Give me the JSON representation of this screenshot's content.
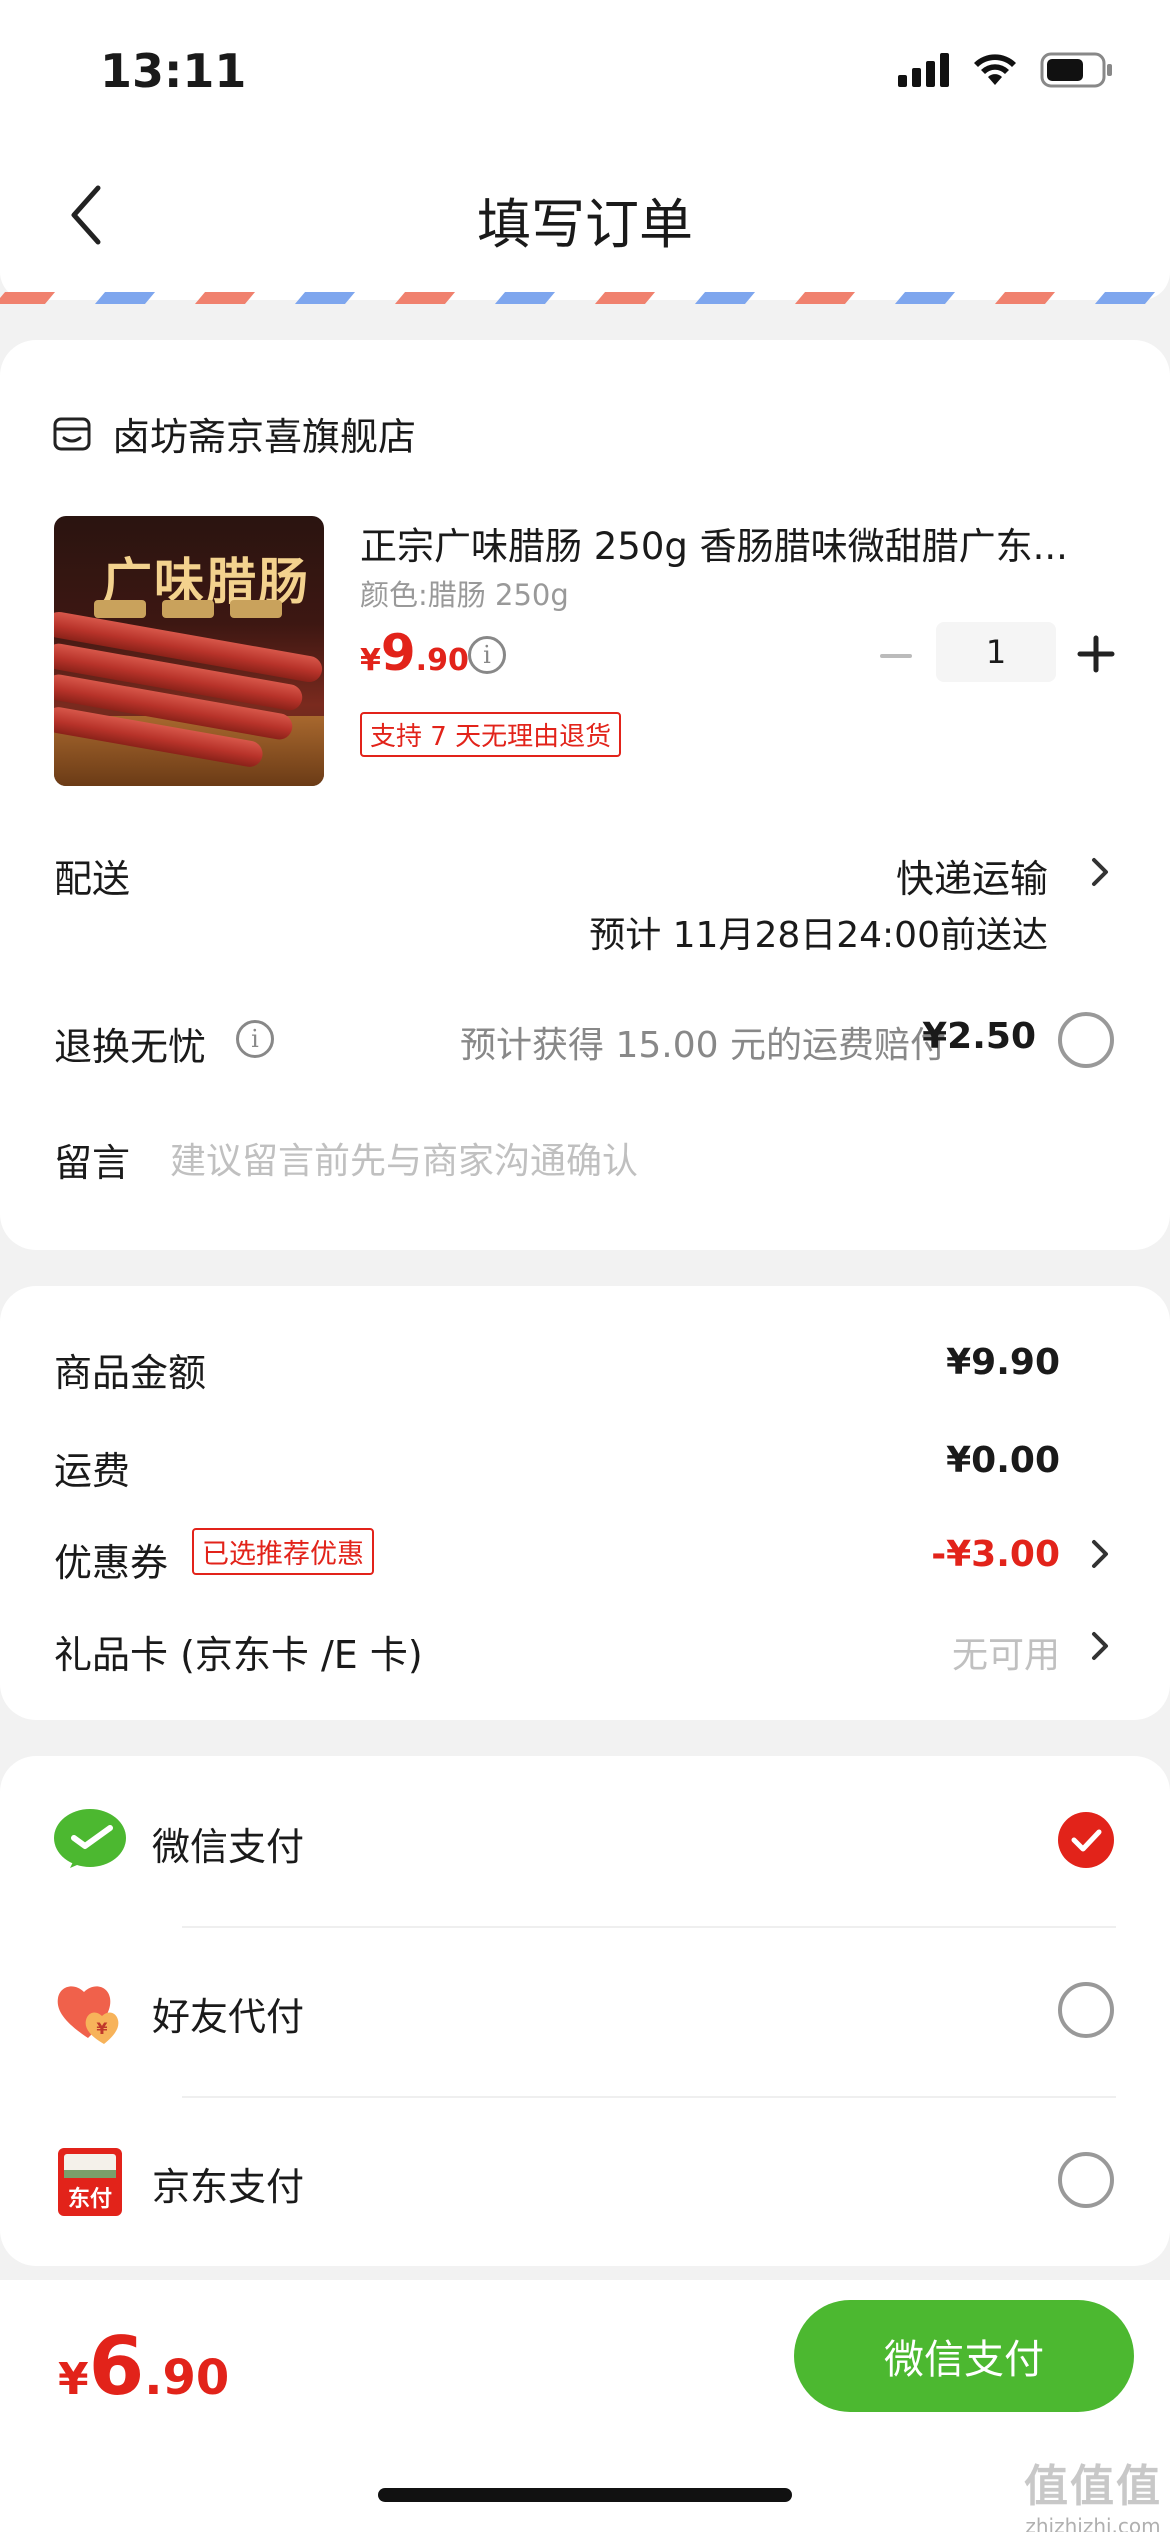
{
  "status_bar": {
    "time": "13:11"
  },
  "nav": {
    "title": "填写订单"
  },
  "store": {
    "name": "卤坊斋京喜旗舰店"
  },
  "product": {
    "image_text": "广味腊肠",
    "title": "正宗广味腊肠 250g 香肠腊味微甜腊广东...",
    "spec": "颜色:腊肠 250g",
    "price": {
      "currency": "¥",
      "integer": "9",
      "decimal": ".90"
    },
    "quantity": "1",
    "return_badge": "支持 7 天无理由退货"
  },
  "delivery": {
    "label": "配送",
    "method": "快递运输",
    "eta": "预计 11月28日24:00前送达"
  },
  "refund": {
    "label": "退换无忧",
    "text": "预计获得 15.00 元的运费赔付",
    "price": "¥2.50"
  },
  "message": {
    "label": "留言",
    "placeholder": "建议留言前先与商家沟通确认"
  },
  "summary": {
    "goods_label": "商品金额",
    "goods_value": "¥9.90",
    "shipping_label": "运费",
    "shipping_value": "¥0.00",
    "coupon_label": "优惠券",
    "coupon_badge": "已选推荐优惠",
    "coupon_value": "-¥3.00",
    "giftcard_label": "礼品卡 (京东卡 /E 卡)",
    "giftcard_value": "无可用"
  },
  "payment": {
    "options": [
      {
        "label": "微信支付",
        "icon": "wechat-pay-icon",
        "selected": true
      },
      {
        "label": "好友代付",
        "icon": "friend-pay-icon",
        "selected": false
      },
      {
        "label": "京东支付",
        "icon": "jd-pay-icon",
        "selected": false
      }
    ],
    "jd_icon_text": "东付"
  },
  "bottom": {
    "total": {
      "currency": "¥",
      "integer": "6",
      "decimal": ".90"
    },
    "pay_button": "微信支付"
  },
  "watermark": {
    "big": "值值值",
    "small": "zhizhizhi.com"
  },
  "colors": {
    "accent_red": "#e2231a",
    "wechat_green": "#4cb830"
  }
}
